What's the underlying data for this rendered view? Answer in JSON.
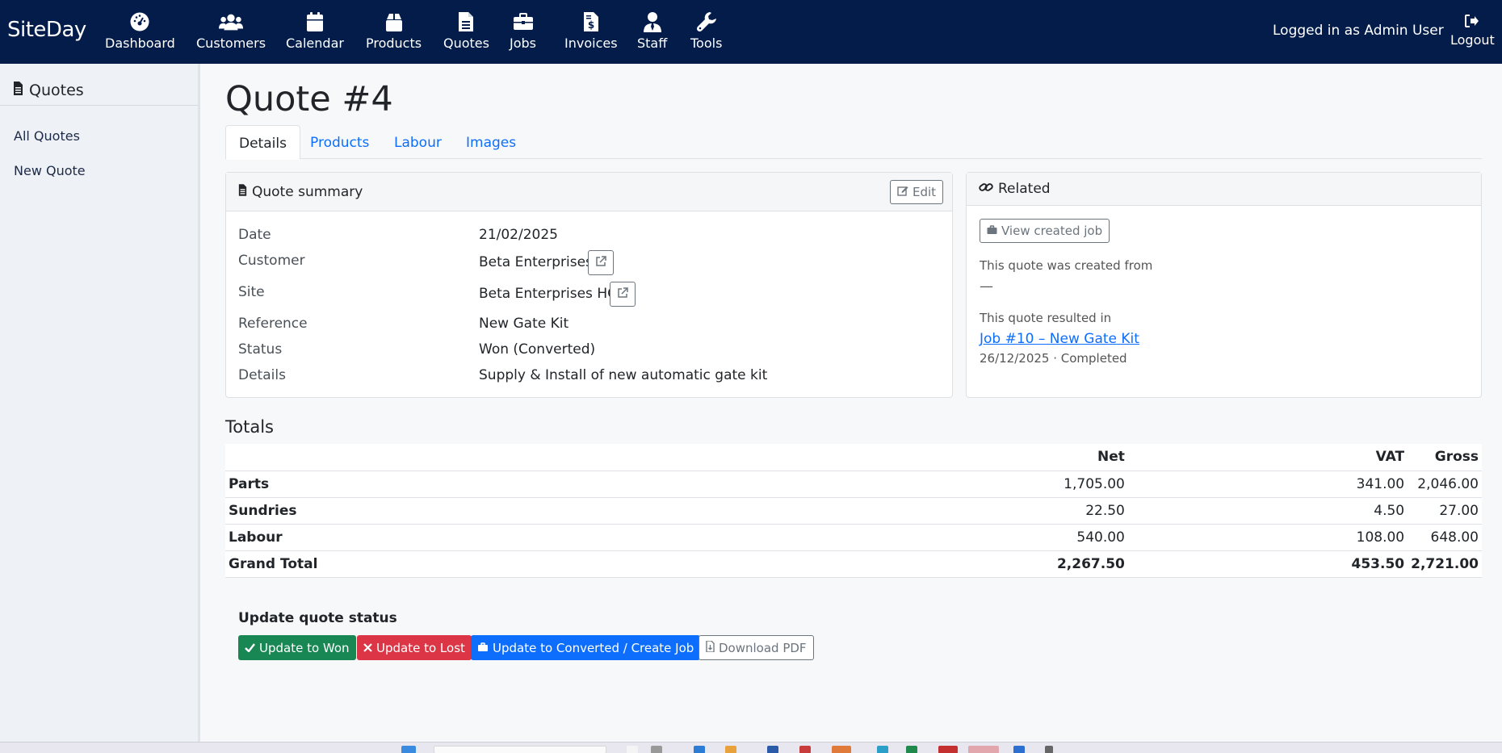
{
  "app": {
    "brand": "SiteDay",
    "nav": [
      {
        "label": "Dashboard",
        "icon": "gauge-icon"
      },
      {
        "label": "Customers",
        "icon": "users-icon"
      },
      {
        "label": "Calendar",
        "icon": "calendar-icon"
      },
      {
        "label": "Products",
        "icon": "box-icon"
      },
      {
        "label": "Quotes",
        "icon": "file-text-icon"
      },
      {
        "label": "Jobs",
        "icon": "briefcase-icon"
      },
      {
        "label": "Invoices",
        "icon": "invoice-dollar-icon"
      },
      {
        "label": "Staff",
        "icon": "user-tie-icon"
      },
      {
        "label": "Tools",
        "icon": "wrench-icon"
      }
    ],
    "logged_in": "Logged in as Admin User",
    "logout": "Logout"
  },
  "sidebar": {
    "title": "Quotes",
    "links": [
      "All Quotes",
      "New Quote"
    ]
  },
  "page": {
    "title": "Quote #4",
    "tabs": [
      "Details",
      "Products",
      "Labour",
      "Images"
    ],
    "active_tab": "Details"
  },
  "summary": {
    "title": "Quote summary",
    "edit": "Edit",
    "rows": [
      {
        "label": "Date",
        "value": "21/02/2025"
      },
      {
        "label": "Customer",
        "value": "Beta Enterprises"
      },
      {
        "label": "Site",
        "value": "Beta Enterprises HQ"
      },
      {
        "label": "Reference",
        "value": "New Gate Kit"
      },
      {
        "label": "Status",
        "value": "Won (Converted)"
      },
      {
        "label": "Details",
        "value": "Supply & Install of new automatic gate kit"
      }
    ]
  },
  "related": {
    "title": "Related",
    "view_job": "View created job",
    "created_from_label": "This quote was created from",
    "created_from_value": "—",
    "resulted_in_label": "This quote resulted in",
    "job_link": "Job #10 – New Gate Kit",
    "job_meta": "26/12/2025 · Completed"
  },
  "totals": {
    "title": "Totals",
    "headers": [
      "Net",
      "VAT",
      "Gross"
    ],
    "rows": [
      {
        "label": "Parts",
        "net": "1,705.00",
        "vat": "341.00",
        "gross": "2,046.00"
      },
      {
        "label": "Sundries",
        "net": "22.50",
        "vat": "4.50",
        "gross": "27.00"
      },
      {
        "label": "Labour",
        "net": "540.00",
        "vat": "108.00",
        "gross": "648.00"
      },
      {
        "label": "Grand Total",
        "net": "2,267.50",
        "vat": "453.50",
        "gross": "2,721.00"
      }
    ]
  },
  "status_update": {
    "title": "Update quote status",
    "won": "Update to Won",
    "lost": "Update to Lost",
    "converted": "Update to Converted / Create Job",
    "pdf": "Download PDF"
  },
  "colors": {
    "nav_bg": "#031c4a",
    "primary": "#0d6efd",
    "success": "#198754",
    "danger": "#dc3545"
  }
}
